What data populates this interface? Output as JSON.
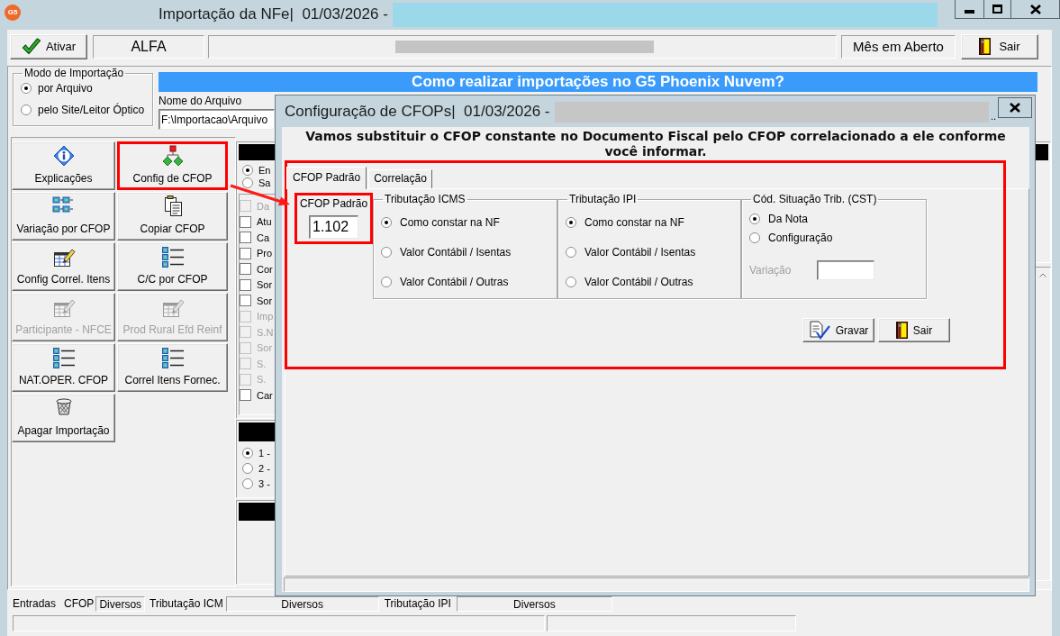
{
  "window": {
    "logo_text": "G5",
    "title": "Importação da NFe|  01/03/2026 -"
  },
  "toolbar": {
    "activate_button": "Ativar",
    "company": "ALFA",
    "period": "Mês em Aberto",
    "exit_button": "Sair"
  },
  "import_mode": {
    "title": "Modo de Importação",
    "options": [
      {
        "label": "por Arquivo",
        "selected": true
      },
      {
        "label": "pelo Site/Leitor Óptico",
        "selected": false
      }
    ]
  },
  "file_name": {
    "label": "Nome do Arquivo",
    "value": "F:\\Importacao\\Arquivo"
  },
  "help_banner": "Como realizar importações no G5 Phoenix Nuvem?",
  "actions": [
    {
      "label": "Explicações",
      "disabled": false,
      "highlighted": false
    },
    {
      "label": "Config de CFOP",
      "disabled": false,
      "highlighted": true
    },
    {
      "label": "Variação por CFOP",
      "disabled": false,
      "highlighted": false
    },
    {
      "label": "Copiar CFOP",
      "disabled": false,
      "highlighted": false
    },
    {
      "label": "Config Correl. Itens",
      "disabled": false,
      "highlighted": false
    },
    {
      "label": "C/C por CFOP",
      "disabled": false,
      "highlighted": false
    },
    {
      "label": "Participante - NFCE",
      "disabled": true,
      "highlighted": false
    },
    {
      "label": "Prod Rural Efd Reinf",
      "disabled": true,
      "highlighted": false
    },
    {
      "label": "NAT.OPER. CFOP",
      "disabled": false,
      "highlighted": false
    },
    {
      "label": "Correl Itens Fornec.",
      "disabled": false,
      "highlighted": false
    },
    {
      "label": "Apagar Importação",
      "disabled": false,
      "highlighted": false
    }
  ],
  "movement": [
    {
      "label": "En",
      "selected": true
    },
    {
      "label": "Sa",
      "selected": false
    }
  ],
  "options": [
    {
      "label": "Da",
      "checked": false,
      "disabled": true
    },
    {
      "label": "Atu",
      "checked": false,
      "disabled": false
    },
    {
      "label": "Ca",
      "checked": false,
      "disabled": false
    },
    {
      "label": "Pro",
      "checked": false,
      "disabled": false
    },
    {
      "label": "Cor",
      "checked": false,
      "disabled": false
    },
    {
      "label": "Sor",
      "checked": false,
      "disabled": false
    },
    {
      "label": "Sor",
      "checked": false,
      "disabled": false
    },
    {
      "label": "Imp",
      "checked": false,
      "disabled": true
    },
    {
      "label": "S.N",
      "checked": false,
      "disabled": true
    },
    {
      "label": "Sor",
      "checked": false,
      "disabled": true
    },
    {
      "label": "S.",
      "checked": false,
      "disabled": true
    },
    {
      "label": "S.",
      "checked": false,
      "disabled": true
    },
    {
      "label": "Car",
      "checked": false,
      "disabled": false
    }
  ],
  "numbered_options": [
    {
      "label": "1 -",
      "selected": true
    },
    {
      "label": "2 -",
      "selected": false
    },
    {
      "label": "3 -",
      "selected": false
    }
  ],
  "dialog": {
    "title": "Configuração de CFOPs|  01/03/2026 -",
    "title_tail": "..",
    "heading": "Vamos substituir o CFOP constante no Documento Fiscal pelo CFOP correlacionado a ele conforme você informar.",
    "tabs": [
      {
        "label": "CFOP Padrão",
        "selected": true
      },
      {
        "label": "Correlação",
        "selected": false
      }
    ],
    "tabs_highlighted": true,
    "default_cfop": {
      "label": "CFOP Padrão",
      "value": "1.102",
      "highlighted": true
    },
    "tax_groups": [
      {
        "title": "Tributação ICMS",
        "options": [
          {
            "label": "Como constar na NF",
            "selected": true
          },
          {
            "label": "Valor Contábil / Isentas",
            "selected": false
          },
          {
            "label": "Valor Contábil / Outras",
            "selected": false
          }
        ]
      },
      {
        "title": "Tributação IPI",
        "options": [
          {
            "label": "Como constar na NF",
            "selected": true
          },
          {
            "label": "Valor Contábil / Isentas",
            "selected": false
          },
          {
            "label": "Valor Contábil / Outras",
            "selected": false
          }
        ]
      }
    ],
    "cst": {
      "title": "Cód. Situação Trib. (CST)",
      "options": [
        {
          "label": "Da Nota",
          "selected": true
        },
        {
          "label": "Configuração",
          "selected": false
        }
      ],
      "variation": {
        "label": "Variação",
        "disabled": true
      }
    },
    "buttons": [
      {
        "label": "Gravar"
      },
      {
        "label": "Sair"
      }
    ]
  },
  "status_bar": [
    {
      "kind": "label",
      "text": "Entradas"
    },
    {
      "kind": "label",
      "text": "CFOP"
    },
    {
      "kind": "field",
      "text": "Diversos"
    },
    {
      "kind": "label",
      "text": "Tributação ICM"
    },
    {
      "kind": "field",
      "text": "Diversos"
    },
    {
      "kind": "label",
      "text": "Tributação IPI"
    },
    {
      "kind": "field",
      "text": "Diversos"
    }
  ]
}
